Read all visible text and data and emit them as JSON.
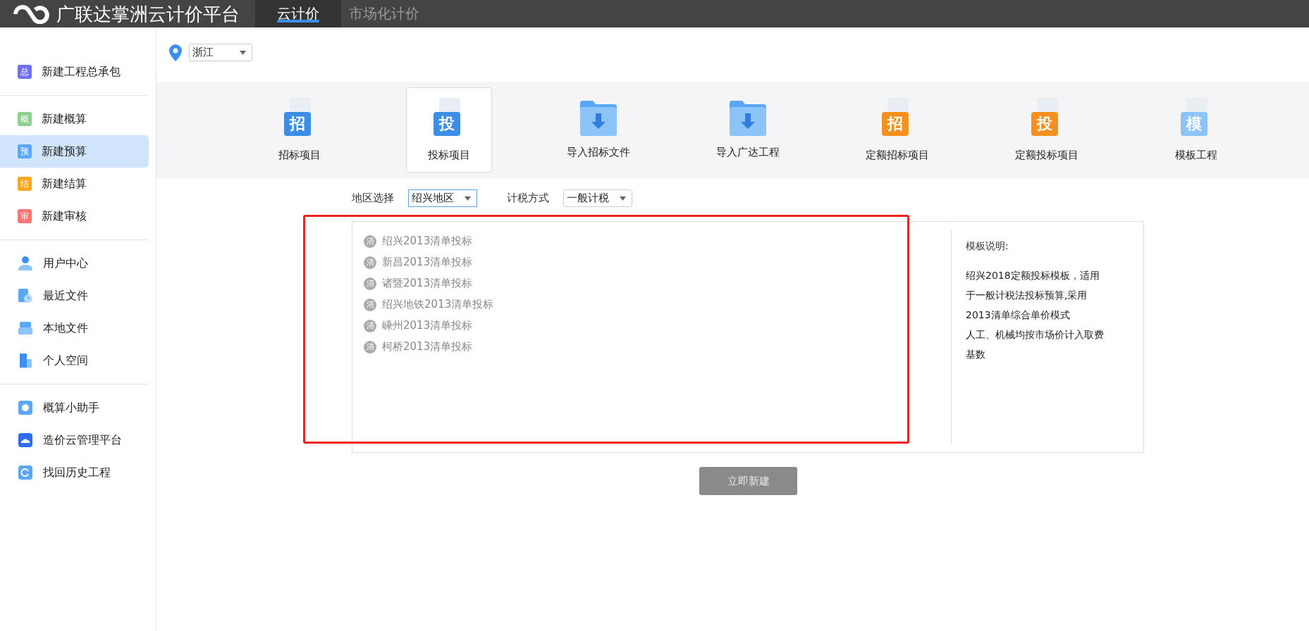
{
  "header": {
    "title": "广联达掌洲云计价平台",
    "tabs": [
      {
        "label": "云计价",
        "selected": true
      },
      {
        "label": "市场化计价",
        "selected": false
      }
    ]
  },
  "province": {
    "value": "浙江"
  },
  "sidebar": {
    "groups": [
      {
        "items": [
          {
            "label": "新建工程总承包",
            "badge": "总",
            "color": "#6f72ee",
            "selected": false
          }
        ]
      },
      {
        "items": [
          {
            "label": "新建概算",
            "badge": "概",
            "color": "#8fd08f",
            "selected": false
          },
          {
            "label": "新建预算",
            "badge": "预",
            "color": "#5aa6f8",
            "selected": true
          },
          {
            "label": "新建结算",
            "badge": "结",
            "color": "#ffa51f",
            "selected": false
          },
          {
            "label": "新建审核",
            "badge": "审",
            "color": "#f97474",
            "selected": false
          }
        ]
      },
      {
        "items": [
          {
            "label": "用户中心",
            "selected": false
          },
          {
            "label": "最近文件",
            "selected": false
          },
          {
            "label": "本地文件",
            "selected": false
          },
          {
            "label": "个人空间",
            "selected": false
          }
        ]
      },
      {
        "items": [
          {
            "label": "概算小助手",
            "selected": false
          },
          {
            "label": "造价云管理平台",
            "selected": false
          },
          {
            "label": "找回历史工程",
            "selected": false
          }
        ]
      }
    ]
  },
  "project_types": [
    {
      "label": "招标项目",
      "kind": "doc",
      "badge": "招",
      "color": "#3a8ee6",
      "selected": false
    },
    {
      "label": "投标项目",
      "kind": "doc",
      "badge": "投",
      "color": "#3a8ee6",
      "selected": true
    },
    {
      "label": "导入招标文件",
      "kind": "folder",
      "selected": false
    },
    {
      "label": "导入广达工程",
      "kind": "folder",
      "selected": false
    },
    {
      "label": "定额招标项目",
      "kind": "doc",
      "badge": "招",
      "color": "#f5901e",
      "selected": false
    },
    {
      "label": "定额投标项目",
      "kind": "doc",
      "badge": "投",
      "color": "#f5901e",
      "selected": false
    },
    {
      "label": "模板工程",
      "kind": "doc",
      "badge": "模",
      "color": "#8cc4f8",
      "selected": false
    }
  ],
  "filters": [
    {
      "label": "地区选择",
      "value": "绍兴地区",
      "focused": true
    },
    {
      "label": "计税方式",
      "value": "一般计税",
      "focused": false
    }
  ],
  "templates": [
    {
      "badge": "清",
      "label": "绍兴2013清单投标"
    },
    {
      "badge": "清",
      "label": "新昌2013清单投标"
    },
    {
      "badge": "清",
      "label": "诸暨2013清单投标"
    },
    {
      "badge": "清",
      "label": "绍兴地铁2013清单投标"
    },
    {
      "badge": "清",
      "label": "嵊州2013清单投标"
    },
    {
      "badge": "清",
      "label": "柯桥2013清单投标"
    }
  ],
  "description": {
    "title": "模板说明:",
    "lines": [
      "绍兴2018定额投标模板，适用",
      "于一般计税法投标预算,采用",
      "2013清单综合单价模式",
      "人工、机械均按市场价计入取费",
      "基数"
    ]
  },
  "create_button": {
    "label": "立即新建"
  }
}
